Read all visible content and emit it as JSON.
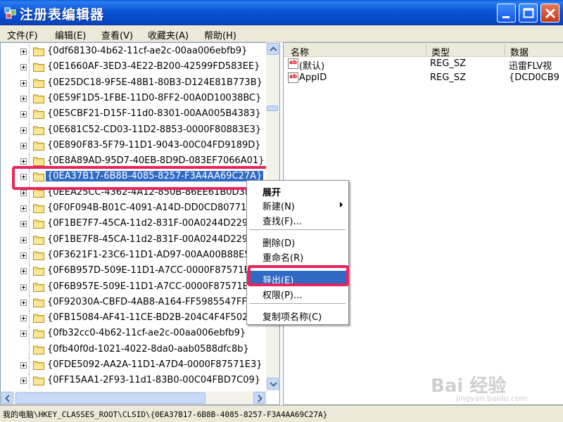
{
  "window": {
    "title": "注册表编辑器",
    "minimize_label": "_",
    "maximize_label": "□",
    "close_label": "×"
  },
  "menu": {
    "items": [
      "文件(F)",
      "编辑(E)",
      "查看(V)",
      "收藏夹(A)",
      "帮助(H)"
    ]
  },
  "tree": {
    "items": [
      "{0df68130-4b62-11cf-ae2c-00aa006ebfb9}",
      "{0E1660AF-3ED3-4E22-B200-42599FD583EE}",
      "{0E25DC18-9F5E-48B1-80B3-D124E81B773B}",
      "{0E59F1D5-1FBE-11D0-8FF2-00A0D10038BC}",
      "{0E5CBF21-D15F-11d0-8301-00AA005B4383}",
      "{0E681C52-CD03-11D2-8853-0000F80883E3}",
      "{0E890F83-5F79-11D1-9043-00C04FD9189D}",
      "{0E8A89AD-95D7-40EB-8D9D-083EF7066A01}",
      "{0EA37B17-6B8B-4085-8257-F3A4AA69C27A}",
      "{0EEA25CC-4362-4A12-850B-86EE61B0D3EB}",
      "{0F0F094B-B01C-4091-A14D-DD0CD807711A}",
      "{0F1BE7F7-45CA-11d2-831F-00A0244D2298}",
      "{0F1BE7F8-45CA-11d2-831F-00A0244D2298}",
      "{0F3621F1-23C6-11D1-AD97-00AA00B88E5A}",
      "{0F6B957D-509E-11D1-A7CC-0000F87571E3}",
      "{0F6B957E-509E-11D1-A7CC-0000F87571E3}",
      "{0F92030A-CBFD-4AB8-A164-FF5985547FF6}",
      "{0FB15084-AF41-11CE-BD2B-204C4F4F5020}",
      "{0fb32cc0-4b62-11cf-ae2c-00aa006ebfb9}",
      "{0fb40f0d-1021-4022-8da0-aab0588dfc8b}",
      "{0FDE5092-AA2A-11D1-A7D4-0000F87571E3}",
      "{0FF15AA1-2F93-11d1-83B0-00C04FBD7C09}"
    ],
    "selected_index": 8,
    "no_expander_index": 19
  },
  "list": {
    "columns": [
      "名称",
      "类型",
      "数据"
    ],
    "rows": [
      {
        "name": "(默认)",
        "type": "REG_SZ",
        "data": "迅雷FLV视"
      },
      {
        "name": "AppID",
        "type": "REG_SZ",
        "data": "{DCD0CB9"
      }
    ]
  },
  "context_menu": {
    "items": [
      {
        "label": "展开",
        "bold": true
      },
      {
        "label": "新建(N)",
        "submenu": true
      },
      {
        "label": "查找(F)..."
      },
      {
        "label": "删除(D)"
      },
      {
        "label": "重命名(R)"
      },
      {
        "label": "导出(E)",
        "hover": true
      },
      {
        "label": "权限(P)..."
      },
      {
        "label": "复制项名称(C)"
      }
    ]
  },
  "status": {
    "path": "我的电脑\\HKEY_CLASSES_ROOT\\CLSID\\{0EA37B17-6B8B-4085-8257-F3A4AA69C27A}"
  },
  "watermark": {
    "text": "Bai 经验",
    "sub": "jingyan.baidu.com"
  },
  "colors": {
    "title_bar": "#0a53d6",
    "selection": "#316ac5",
    "annotation": "#e8245c",
    "menubar": "#ece9d8"
  }
}
